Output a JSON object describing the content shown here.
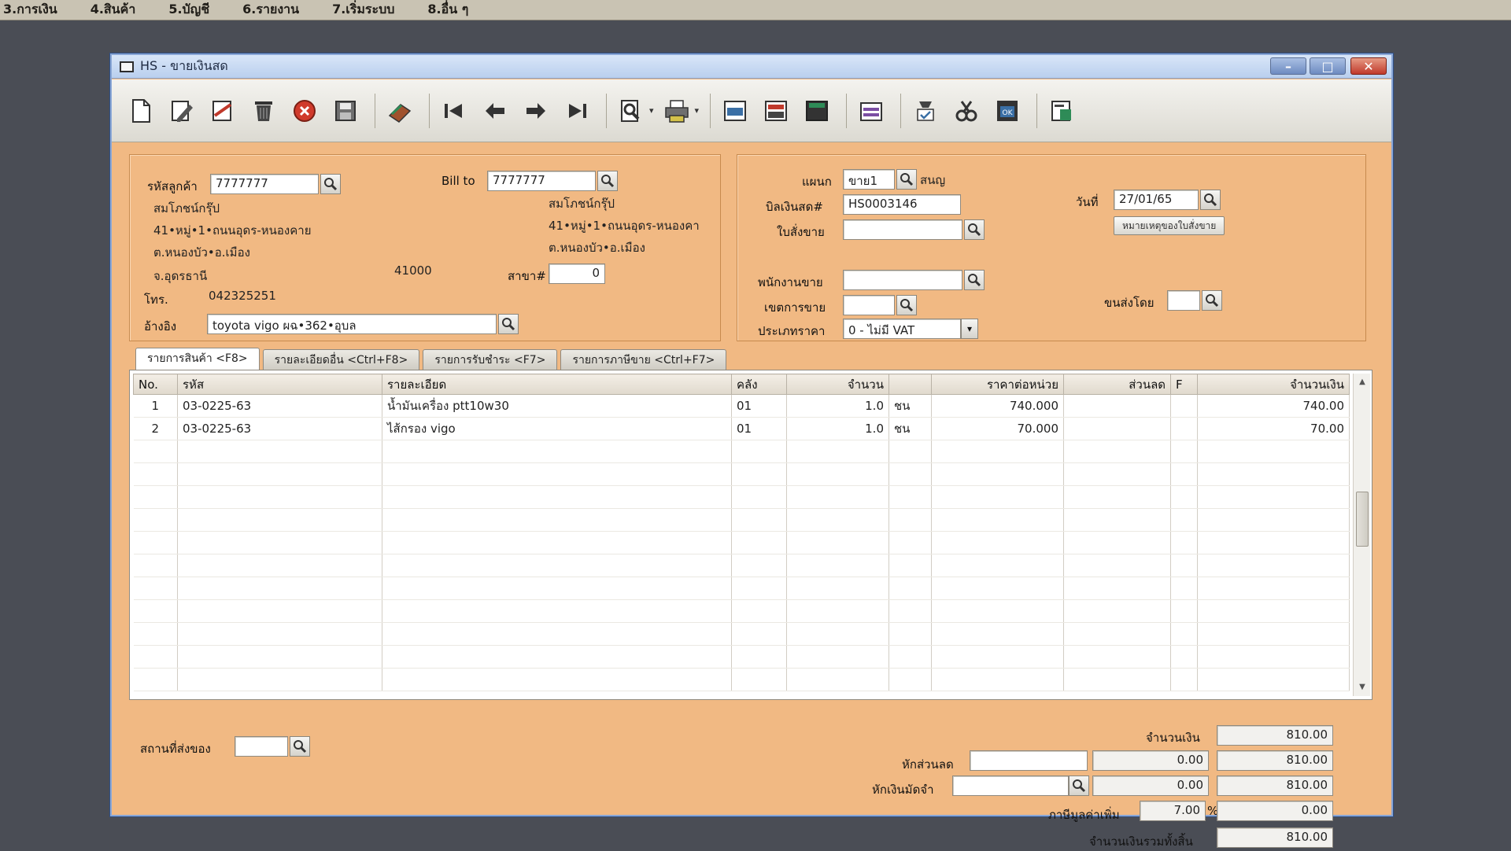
{
  "menu": [
    "3.การเงิน",
    "4.สินค้า",
    "5.บัญชี",
    "6.รายงาน",
    "7.เริ่มระบบ",
    "8.อื่น ๆ"
  ],
  "window": {
    "title": "HS - ขายเงินสด",
    "minimize": "–",
    "maximize": "□",
    "close": "✕"
  },
  "toolbar": {
    "icons": [
      "new-icon",
      "edit-icon",
      "cancel-doc-icon",
      "delete-icon",
      "stop-icon",
      "save-icon",
      "book-icon",
      "first-icon",
      "prev-icon",
      "next-icon",
      "last-icon",
      "find-icon",
      "print-icon",
      "form1-icon",
      "form2-icon",
      "form3-icon",
      "form4-icon",
      "approve-icon",
      "tools-icon",
      "ok-icon",
      "calc-icon"
    ],
    "dropdown_glyph": "▾"
  },
  "customer": {
    "code_label": "รหัสลูกค้า",
    "code": "7777777",
    "name": "สมโภชน์กรุ๊ป",
    "addr1": "41•หมู่•1•ถนนอุดร-หนองคาย",
    "addr2": "ต.หนองบัว•อ.เมือง",
    "addr3": "จ.อุดรธานี",
    "zip": "41000",
    "phone_label": "โทร.",
    "phone": "042325251",
    "ref_label": "อ้างอิง",
    "ref": "toyota vigo ผฉ•362•อุบล",
    "billto_label": "Bill to",
    "billto_code": "7777777",
    "billto_name": "สมโภชน์กรุ๊ป",
    "billto_addr1": "41•หมู่•1•ถนนอุดร-หนองคา",
    "billto_addr2": "ต.หนองบัว•อ.เมือง",
    "branch_label": "สาขา#",
    "branch": "0"
  },
  "document": {
    "dept_label": "แผนก",
    "dept": "ขาย1",
    "dept_name": "สนญ",
    "bill_label": "บิลเงินสด#",
    "bill_no": "HS0003146",
    "so_label": "ใบสั่งขาย",
    "so": "",
    "date_label": "วันที่",
    "date": "27/01/65",
    "note_button": "หมายเหตุของใบสั่งขาย",
    "salesman_label": "พนักงานขาย",
    "salesman": "",
    "area_label": "เขตการขาย",
    "area": "",
    "ship_label": "ขนส่งโดย",
    "ship": "",
    "pricetype_label": "ประเภทราคา",
    "pricetype": "0 - ไม่มี VAT"
  },
  "tabs": [
    "รายการสินค้า <F8>",
    "รายละเอียดอื่น <Ctrl+F8>",
    "รายการรับชำระ <F7>",
    "รายการภาษีขาย <Ctrl+F7>"
  ],
  "grid": {
    "headers": {
      "no": "No.",
      "code": "รหัส",
      "desc": "รายละเอียด",
      "wh": "คลัง",
      "qty": "จำนวน",
      "unit_price": "ราคาต่อหน่วย",
      "discount": "ส่วนลด",
      "f": "F",
      "amount": "จำนวนเงิน"
    },
    "rows": [
      {
        "no": "1",
        "code": "03-0225-63",
        "desc": "น้ำมันเครื่อง ptt10w30",
        "wh": "01",
        "qty": "1.0",
        "unit": "ชน",
        "unit_price": "740.000",
        "discount": "",
        "f": "",
        "amount": "740.00"
      },
      {
        "no": "2",
        "code": "03-0225-63",
        "desc": "ไส้กรอง vigo",
        "wh": "01",
        "qty": "1.0",
        "unit": "ชน",
        "unit_price": "70.000",
        "discount": "",
        "f": "",
        "amount": "70.00"
      }
    ]
  },
  "footer": {
    "delivery_label": "สถานที่ส่งของ",
    "delivery": "",
    "amount_label": "จำนวนเงิน",
    "amount": "810.00",
    "discount_label": "หักส่วนลด",
    "discount_text": "",
    "discount_value": "0.00",
    "after_discount": "810.00",
    "deposit_label": "หักเงินมัดจำ",
    "deposit_text": "",
    "deposit_value": "0.00",
    "after_deposit": "810.00",
    "vat_label": "ภาษีมูลค่าเพิ่ม",
    "vat_rate": "7.00",
    "vat_pct": "%",
    "vat_amount": "0.00",
    "grand_label": "จำนวนเงินรวมทั้งสิ้น",
    "grand_total": "810.00"
  }
}
